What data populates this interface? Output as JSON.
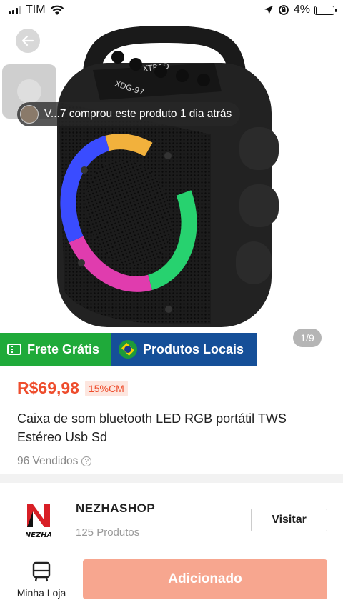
{
  "status_bar": {
    "carrier": "TIM",
    "battery_percent": "4%",
    "battery_level": 0.04
  },
  "gallery": {
    "purchase_toast": "V...7 comprou este produto 1 dia atrás",
    "page_indicator": "1/9",
    "image_brand_text": "XTRAD",
    "image_model_text": "XDG-97"
  },
  "badges": {
    "free_shipping": "Frete Grátis",
    "local_products": "Produtos Locais"
  },
  "product": {
    "price": "R$69,98",
    "discount_tag": "15%CM",
    "title": "Caixa de som bluetooth LED RGB portátil TWS Estéreo Usb Sd",
    "sold": "96 Vendidos",
    "help_symbol": "?"
  },
  "shop": {
    "name": "NEZHASHOP",
    "products": "125 Produtos",
    "visit_label": "Visitar",
    "logo_letter": "N",
    "logo_text": "NEZHA"
  },
  "bottom_bar": {
    "my_store_label": "Minha Loja",
    "add_button_label": "Adicionado"
  },
  "colors": {
    "accent": "#ee4d2d",
    "add_button": "#f7a68f",
    "free_shipping_bg": "#1faa3a",
    "local_products_bg": "#154f98"
  }
}
